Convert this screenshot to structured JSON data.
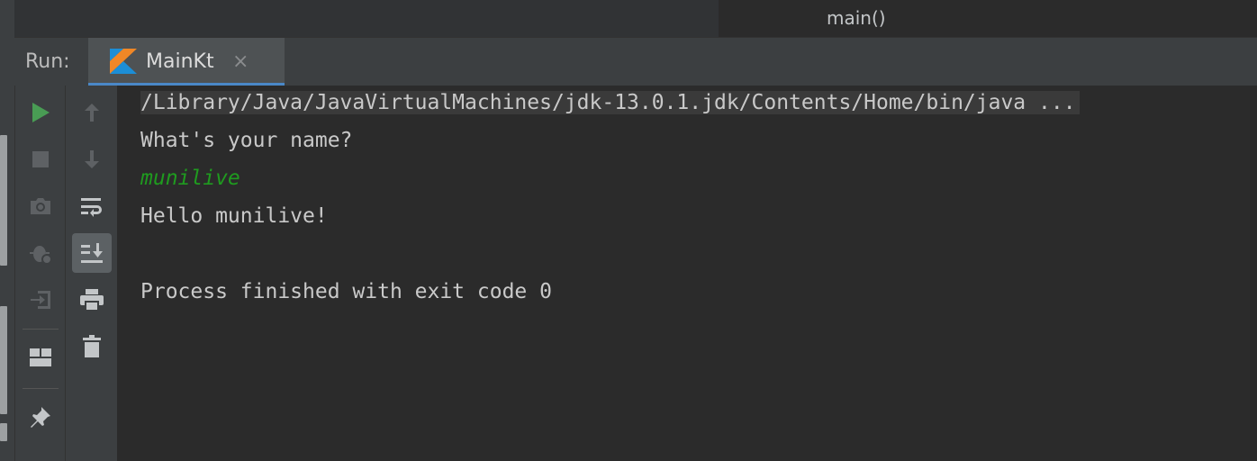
{
  "editor": {
    "breadcrumb": "main()"
  },
  "run": {
    "label": "Run:",
    "tab": {
      "label": "MainKt",
      "close": "×"
    }
  },
  "toolbar": {
    "col1": [
      "run-icon",
      "stop-icon",
      "camera-icon",
      "debug-icon",
      "login-icon",
      "layout-icon",
      "pin-icon"
    ],
    "col2": [
      "arrow-up-icon",
      "arrow-down-icon",
      "soft-wrap-icon",
      "scroll-to-end-icon",
      "print-icon",
      "trash-icon"
    ]
  },
  "console": {
    "lines": [
      "/Library/Java/JavaVirtualMachines/jdk-13.0.1.jdk/Contents/Home/bin/java ...",
      "What's your name?",
      "munilive",
      "Hello munilive!",
      "",
      "Process finished with exit code 0"
    ]
  },
  "colors": {
    "accent": "#4a88c7",
    "run_green": "#499c54",
    "input_green": "#1f9b1f",
    "console_bg": "#2b2b2b",
    "panel_bg": "#3c3f41"
  }
}
